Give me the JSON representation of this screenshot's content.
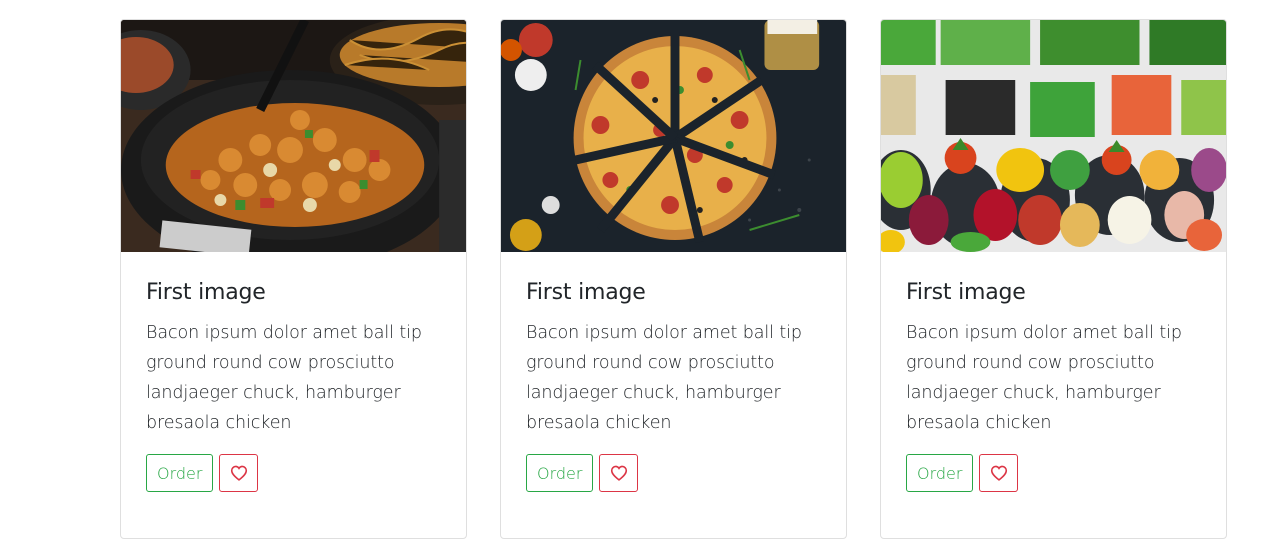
{
  "cards": [
    {
      "image_alt": "fried chicken dish",
      "title": "First image",
      "text": "Bacon ipsum dolor amet ball tip ground round cow prosciutto landjaeger chuck, hamburger bresaola chicken",
      "order_label": "Order",
      "favorite_icon": "heart-icon"
    },
    {
      "image_alt": "pizza",
      "title": "First image",
      "text": "Bacon ipsum dolor amet ball tip ground round cow prosciutto landjaeger chuck, hamburger bresaola chicken",
      "order_label": "Order",
      "favorite_icon": "heart-icon"
    },
    {
      "image_alt": "salad bar vegetables",
      "title": "First image",
      "text": "Bacon ipsum dolor amet ball tip ground round cow prosciutto landjaeger chuck, hamburger bresaola chicken",
      "order_label": "Order",
      "favorite_icon": "heart-icon"
    }
  ],
  "colors": {
    "order_accent": "#28a745",
    "favorite_accent": "#dc3545"
  }
}
